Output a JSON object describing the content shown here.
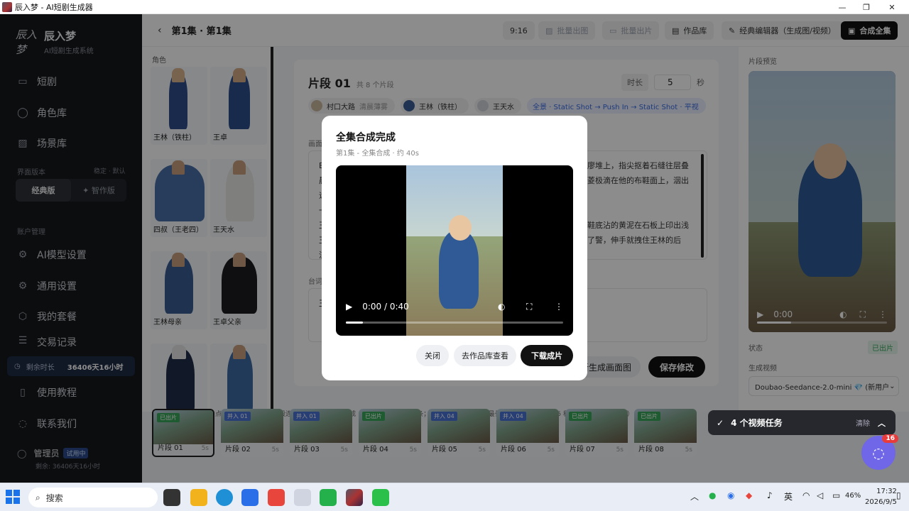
{
  "window": {
    "title": "辰入梦 - AI短剧生成器"
  },
  "sidebar": {
    "logo": "辰入梦",
    "brand_name": "辰入梦",
    "brand_sub": "AI短剧生成系统",
    "nav": [
      {
        "label": "短剧",
        "icon": "film-icon"
      },
      {
        "label": "角色库",
        "icon": "user-icon"
      },
      {
        "label": "场景库",
        "icon": "image-icon"
      }
    ],
    "version_head": "界面版本",
    "version_note": "稳定 · 默认",
    "versions": [
      "经典版",
      "✦ 智作版"
    ],
    "account_head": "账户管理",
    "account_nav": [
      {
        "label": "AI模型设置",
        "icon": "gear-icon"
      },
      {
        "label": "通用设置",
        "icon": "gear-icon"
      },
      {
        "label": "我的套餐",
        "icon": "box-icon"
      },
      {
        "label": "交易记录",
        "icon": "list-icon"
      }
    ],
    "quota_label": "剩余时长",
    "quota_value": "36406天16小时",
    "bottom_nav": [
      {
        "label": "使用教程",
        "icon": "book-icon"
      },
      {
        "label": "联系我们",
        "icon": "chat-icon"
      }
    ],
    "user_name": "管理员",
    "user_tag": "试用中",
    "user_remaining": "剩余: 36406天16小时"
  },
  "topbar": {
    "episode": "第1集 · 第1集",
    "ratio": "9:16",
    "batch_image": "批量出图",
    "batch_video": "批量出片",
    "gallery": "作品库",
    "classic_editor": "经典编辑器（生成图/视频）",
    "compose_all": "合成全集"
  },
  "characters": {
    "heading": "角色",
    "items": [
      "王林（铁柱）",
      "王卓",
      "四叔（王老四）",
      "王天水",
      "王林母亲",
      "王卓父亲",
      "",
      ""
    ]
  },
  "segment": {
    "title": "片段 01",
    "subtitle": "共 8 个片段",
    "duration_label": "时长",
    "duration_value": "5",
    "duration_unit": "秒",
    "chips": [
      {
        "label": "村口大路",
        "meta": "清晨薄雾"
      },
      {
        "label": "王林（铁柱）",
        "meta": ""
      },
      {
        "label": "王天水",
        "meta": ""
      }
    ],
    "shot": "全景 · Static Shot → Push In → Static Shot · 平视",
    "prompt_label": "画面",
    "prompt_lines": [
      "E",
      "晨",
      "远",
      "一",
      "王",
      "王",
      "流",
      "令"
    ],
    "prompt_right": [
      "廖堆上，指尖抠着石缝往层叠",
      "菱极滴在他的布鞋面上，洇出",
      "",
      "",
      "鞋底沾的黄泥在石板上印出浅",
      "了警，伸手就拽住王林的后"
    ],
    "dialog_label": "台词",
    "dialog_first": "王",
    "regen_button": "重新生成画面图",
    "save_button": "保存修改"
  },
  "hint": "连镜合拍：按住 Shift 点击另一个片段选连一段连续镜头，这一行会变成「🎬 连镜合拍」操作条；Seedance 2.5 一次最长 30 秒，2.0 最长 15 秒（合计时长看操作条）",
  "segments": [
    {
      "name": "片段 01",
      "dur": "5s",
      "badge": "已出片",
      "kind": "green"
    },
    {
      "name": "片段 02",
      "dur": "5s",
      "badge": "并入 01",
      "kind": "blue"
    },
    {
      "name": "片段 03",
      "dur": "5s",
      "badge": "并入 01",
      "kind": "blue"
    },
    {
      "name": "片段 04",
      "dur": "5s",
      "badge": "已出片",
      "kind": "green"
    },
    {
      "name": "片段 05",
      "dur": "5s",
      "badge": "并入 04",
      "kind": "blue"
    },
    {
      "name": "片段 06",
      "dur": "5s",
      "badge": "并入 04",
      "kind": "blue"
    },
    {
      "name": "片段 07",
      "dur": "5s",
      "badge": "已出片",
      "kind": "green"
    },
    {
      "name": "片段 08",
      "dur": "5s",
      "badge": "已出片",
      "kind": "green"
    }
  ],
  "right": {
    "heading": "片段预览",
    "time": "0:00",
    "state_label": "状态",
    "state_value": "已出片",
    "gen_label": "生成视频",
    "model": "Doubao-Seedance-2.0-mini 💎 (新用户"
  },
  "toast": {
    "text": "4 个视频任务",
    "clear": "清除"
  },
  "fab": {
    "count": "16"
  },
  "modal": {
    "title": "全集合成完成",
    "subtitle": "第1集 - 全集合成 · 约 40s",
    "time": "0:00 / 0:40",
    "close": "关闭",
    "view_gallery": "去作品库查看",
    "download": "下载成片"
  },
  "taskbar": {
    "search": "搜索",
    "ime": "英",
    "battery": "46%",
    "time": "17:32",
    "date": "2026/9/5"
  }
}
